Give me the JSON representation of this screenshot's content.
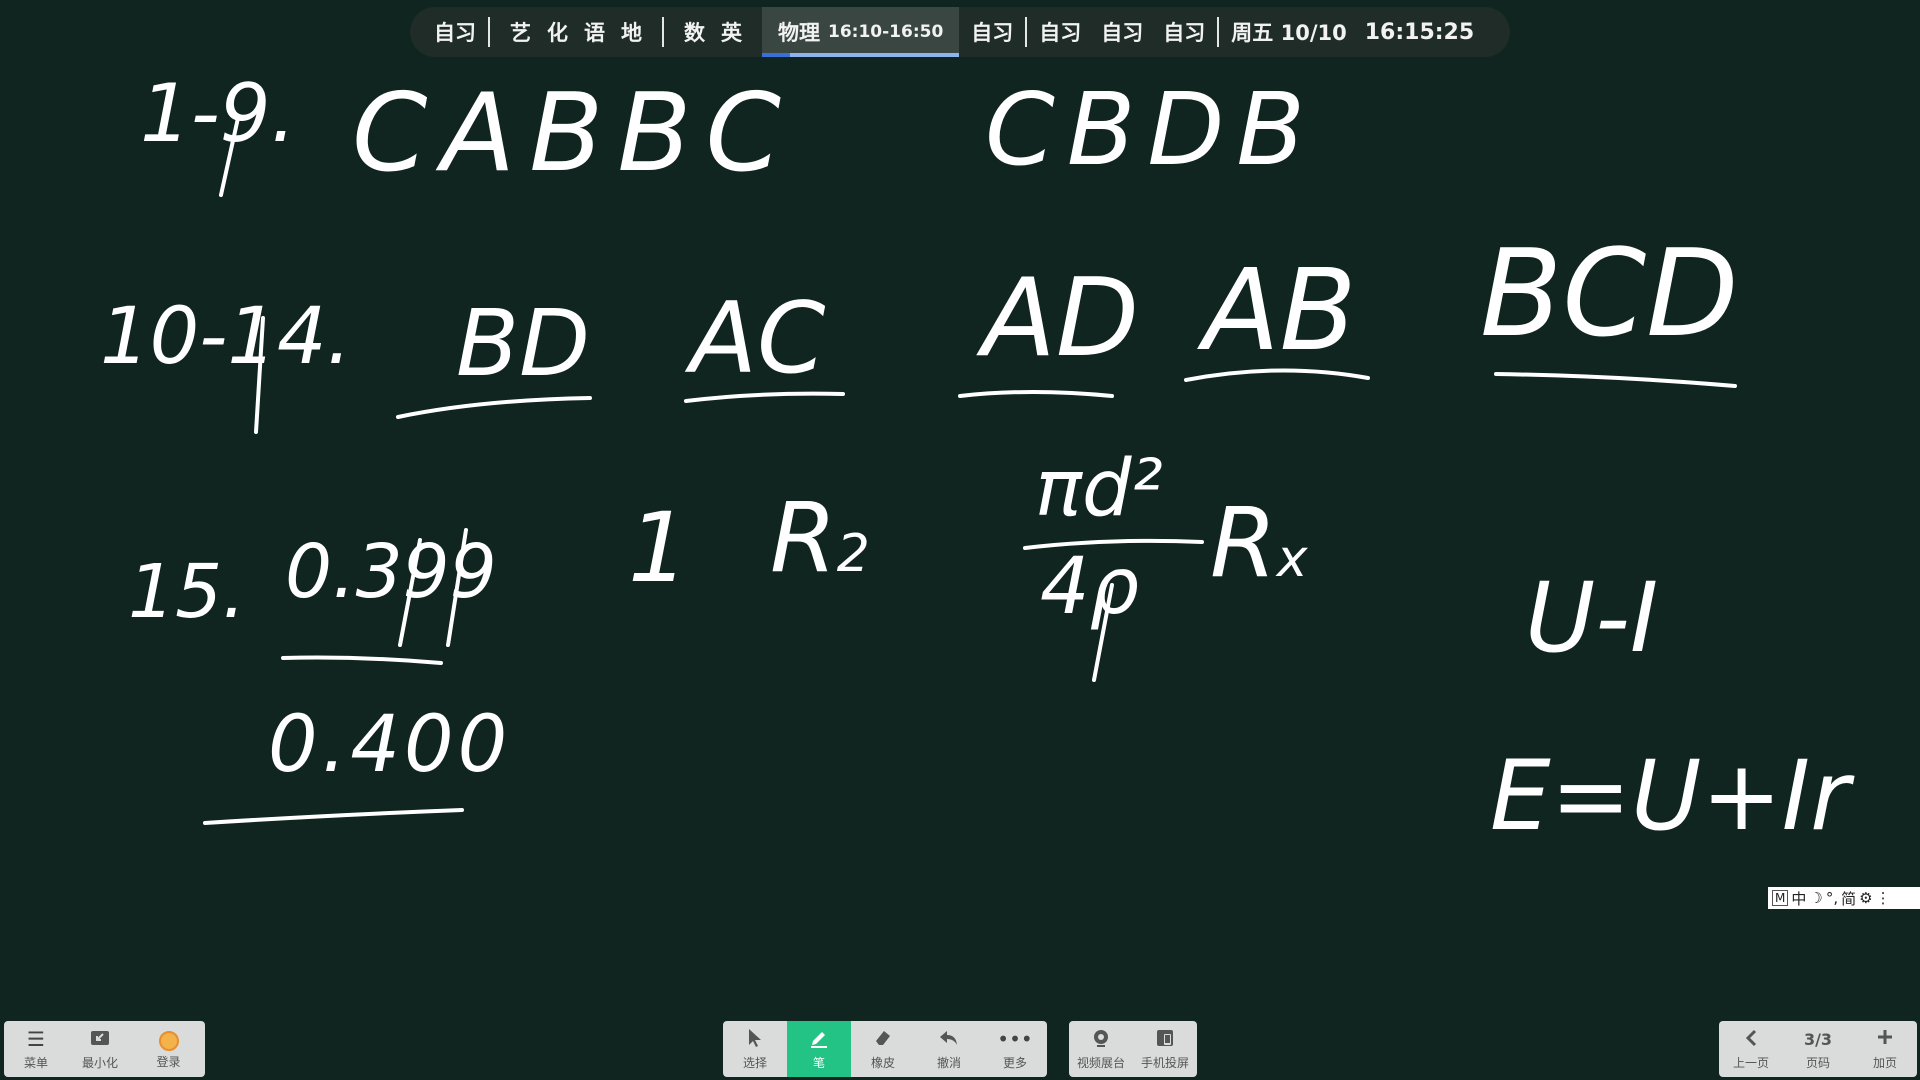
{
  "schedule": {
    "items": [
      {
        "label": "自习"
      },
      {
        "labels": [
          "艺",
          "化",
          "语",
          "地"
        ]
      },
      {
        "labels": [
          "数",
          "英"
        ]
      },
      {
        "label": "物理",
        "time": "16:10-16:50",
        "progress_percent": 14
      },
      {
        "label": "自习"
      },
      {
        "labels": [
          "自习",
          "自习",
          "自习"
        ]
      }
    ],
    "date": "周五 10/10",
    "clock": "16:15:25"
  },
  "board": {
    "row1_label": "1-9.",
    "row1_group1": "CABBC",
    "row1_group2": "CBDB",
    "row2_label": "10-14.",
    "row2_answers": [
      "BD",
      "AC",
      "AD",
      "AB",
      "BCD"
    ],
    "row3_label": "15.",
    "value1": "0.399",
    "value2": "0.400",
    "item_one": "1",
    "r2": "R",
    "r2_sub": "2",
    "formula_numerator": "πd²",
    "formula_denominator": "4ρ",
    "rx": "R",
    "rx_sub": "x",
    "ui": "U-I",
    "emf": "E=U+Ir"
  },
  "ime": {
    "items": [
      "M",
      "中",
      "☽",
      "°,",
      "简",
      "⚙",
      "⋮"
    ]
  },
  "toolbar_left": [
    {
      "icon": "menu-icon",
      "label": "菜单"
    },
    {
      "icon": "minimize-icon",
      "label": "最小化"
    },
    {
      "icon": "avatar-icon",
      "label": "登录"
    }
  ],
  "toolbar_center": [
    {
      "icon": "cursor-icon",
      "label": "选择"
    },
    {
      "icon": "pen-icon",
      "label": "笔",
      "active": true
    },
    {
      "icon": "eraser-icon",
      "label": "橡皮"
    },
    {
      "icon": "undo-icon",
      "label": "撤消"
    },
    {
      "icon": "more-icon",
      "label": "更多"
    }
  ],
  "toolbar_center2": [
    {
      "icon": "camera-icon",
      "label": "视频展台"
    },
    {
      "icon": "phone-cast-icon",
      "label": "手机投屏"
    }
  ],
  "toolbar_right": [
    {
      "icon": "chevron-left-icon",
      "label": "上一页"
    },
    {
      "value": "3/3",
      "label": "页码"
    },
    {
      "icon": "plus-icon",
      "label": "加页"
    }
  ]
}
